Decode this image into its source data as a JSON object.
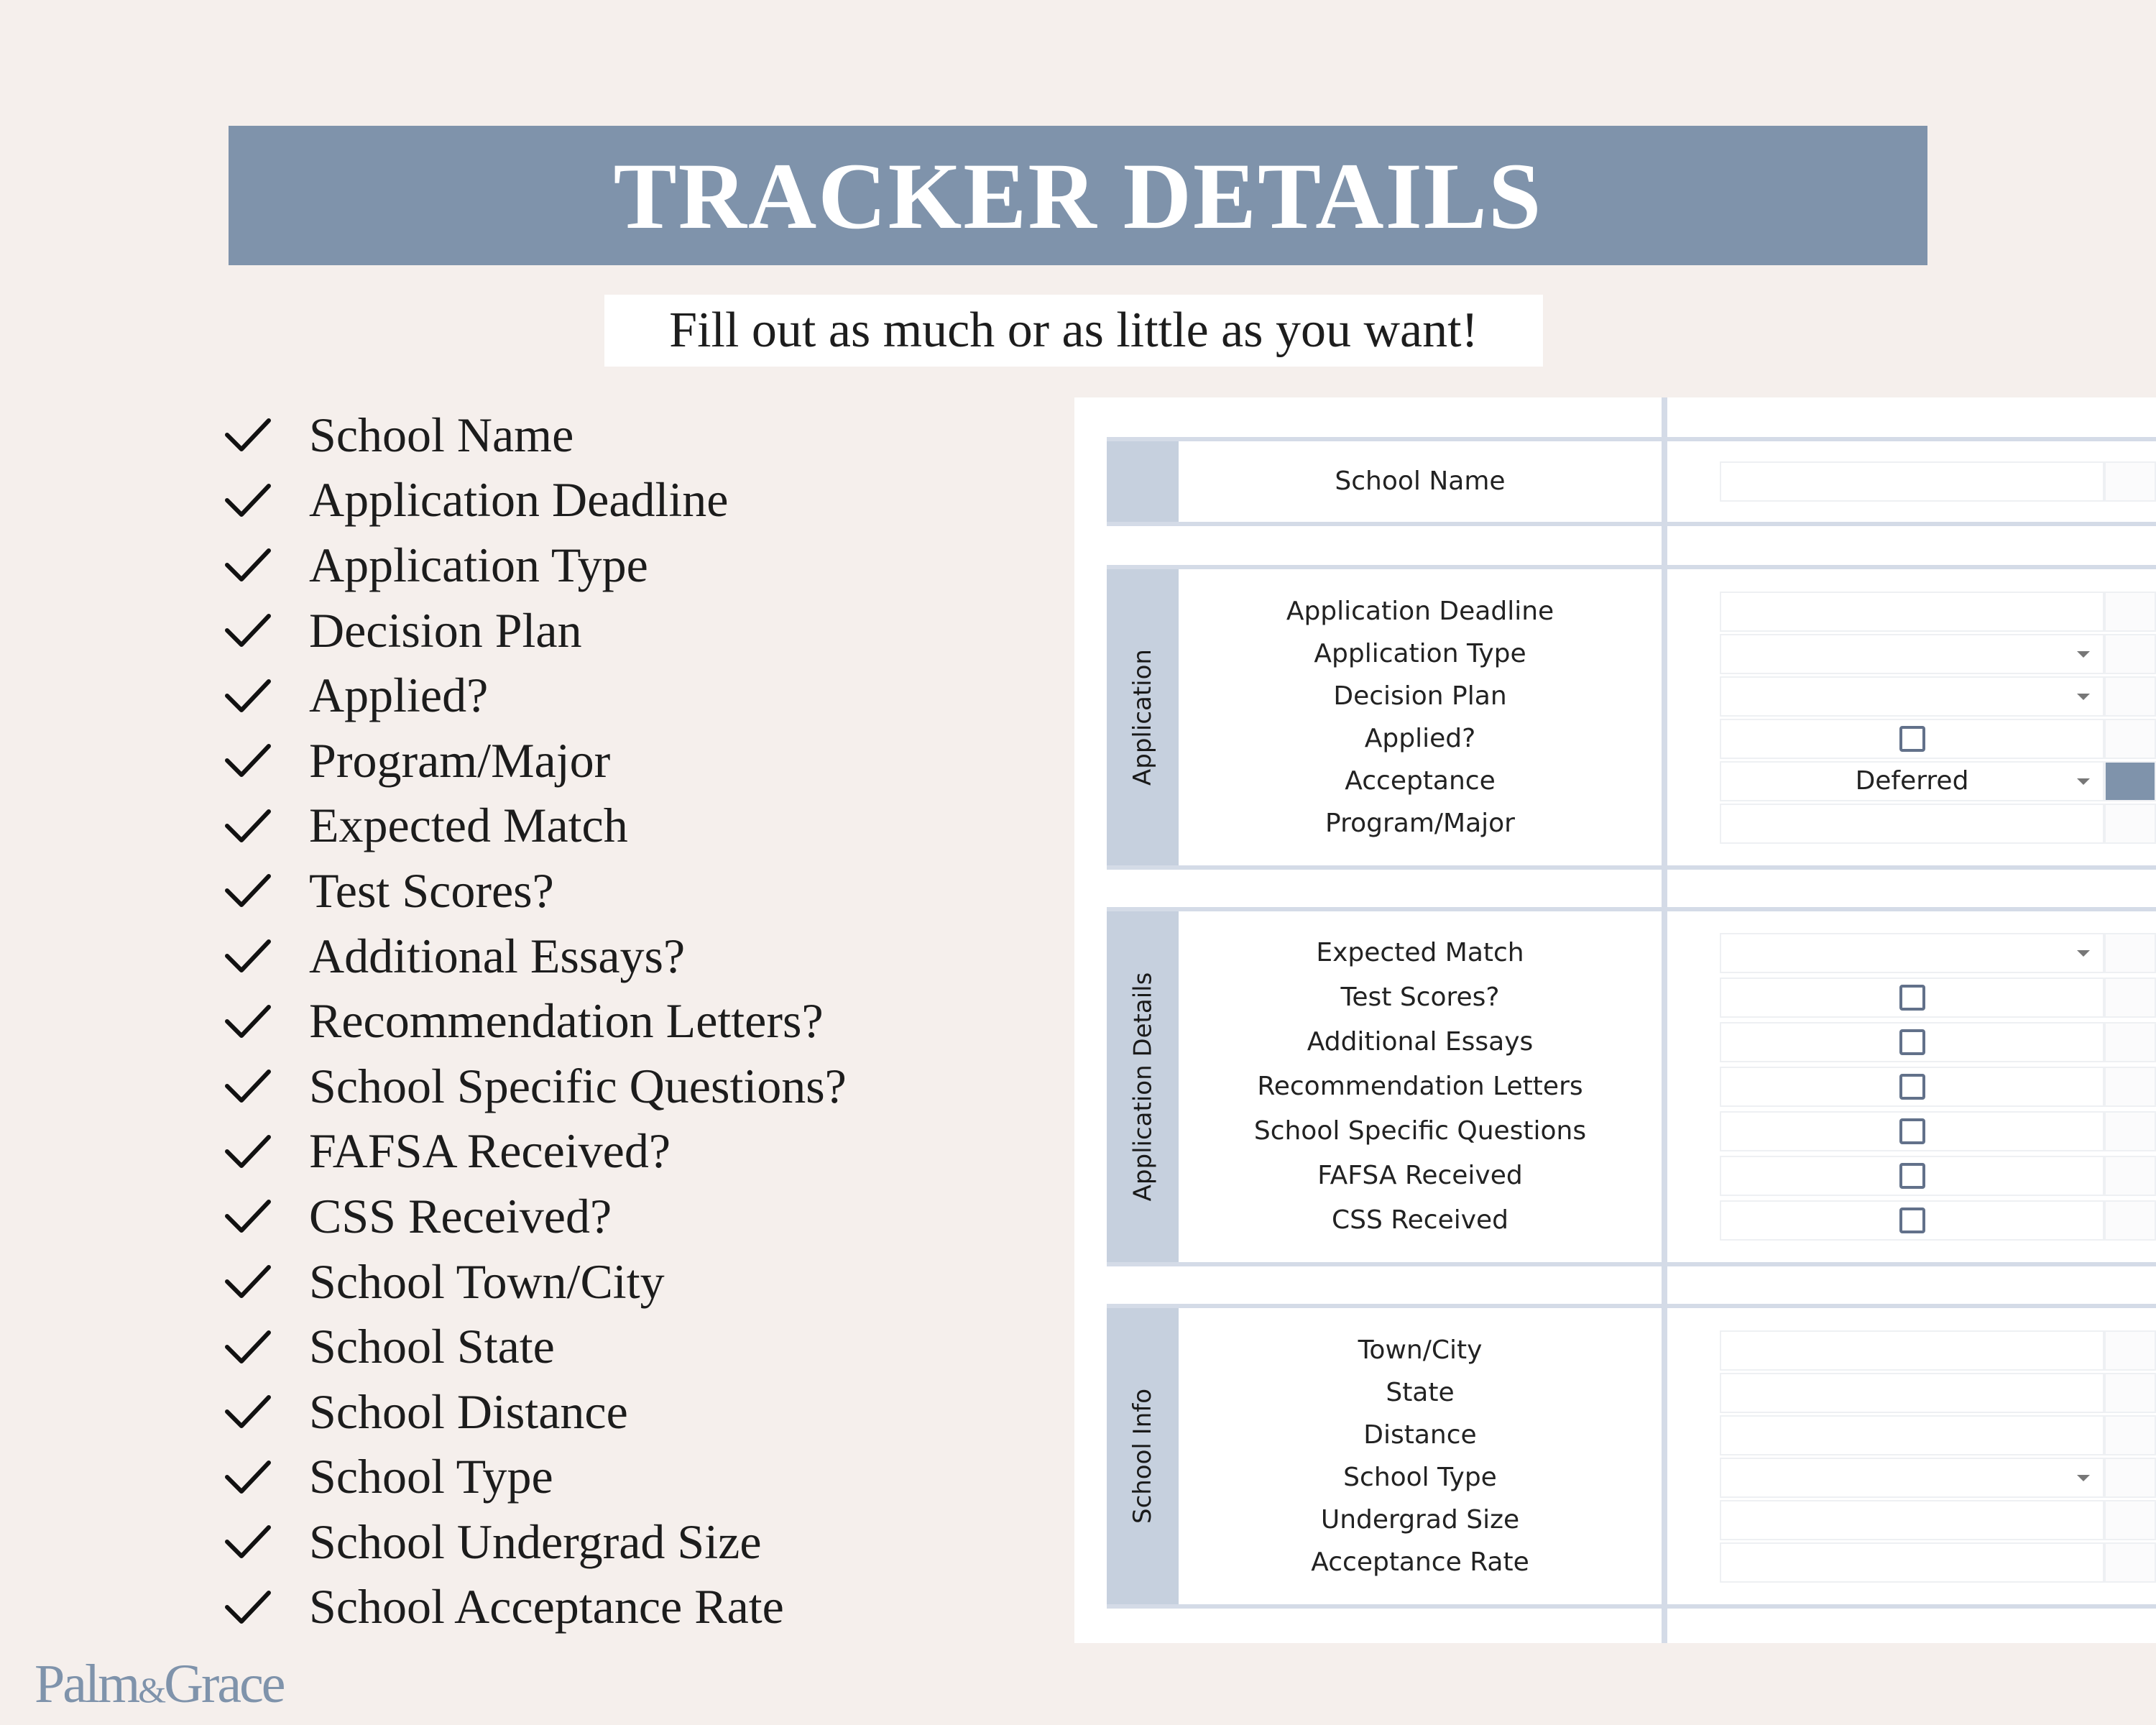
{
  "header": {
    "title": "TRACKER DETAILS",
    "subtitle": "Fill out as much or as little as you want!"
  },
  "checklist": {
    "icon": "checkmark-icon",
    "items": [
      "School Name",
      "Application Deadline",
      "Application Type",
      "Decision Plan",
      "Applied?",
      "Program/Major",
      "Expected Match",
      "Test Scores?",
      "Additional Essays?",
      "Recommendation Letters?",
      "School Specific Questions?",
      "FAFSA Received?",
      "CSS Received?",
      "School Town/City",
      "School State",
      "School Distance",
      "School Type",
      "School Undergrad Size",
      "School Acceptance Rate"
    ]
  },
  "spreadsheet": {
    "sections": [
      {
        "side_label": "",
        "fields": [
          {
            "label": "School Name",
            "type": "text",
            "value": ""
          }
        ]
      },
      {
        "side_label": "Application",
        "fields": [
          {
            "label": "Application Deadline",
            "type": "text",
            "value": ""
          },
          {
            "label": "Application Type",
            "type": "dropdown",
            "value": ""
          },
          {
            "label": "Decision Plan",
            "type": "dropdown",
            "value": ""
          },
          {
            "label": "Applied?",
            "type": "checkbox",
            "checked": false
          },
          {
            "label": "Acceptance",
            "type": "dropdown",
            "value": "Deferred"
          },
          {
            "label": "Program/Major",
            "type": "text",
            "value": ""
          }
        ]
      },
      {
        "side_label": "Application Details",
        "fields": [
          {
            "label": "Expected Match",
            "type": "dropdown",
            "value": ""
          },
          {
            "label": "Test Scores?",
            "type": "checkbox",
            "checked": false
          },
          {
            "label": "Additional Essays",
            "type": "checkbox",
            "checked": false
          },
          {
            "label": "Recommendation Letters",
            "type": "checkbox",
            "checked": false
          },
          {
            "label": "School Specific Questions",
            "type": "checkbox",
            "checked": false
          },
          {
            "label": "FAFSA Received",
            "type": "checkbox",
            "checked": false
          },
          {
            "label": "CSS Received",
            "type": "checkbox",
            "checked": false
          }
        ]
      },
      {
        "side_label": "School Info",
        "fields": [
          {
            "label": "Town/City",
            "type": "text",
            "value": ""
          },
          {
            "label": "State",
            "type": "text",
            "value": ""
          },
          {
            "label": "Distance",
            "type": "text",
            "value": ""
          },
          {
            "label": "School Type",
            "type": "dropdown",
            "value": ""
          },
          {
            "label": "Undergrad Size",
            "type": "text",
            "value": ""
          },
          {
            "label": "Acceptance Rate",
            "type": "text",
            "value": ""
          }
        ]
      }
    ]
  },
  "brand": {
    "name_left": "Palm",
    "amp": "&",
    "name_right": "Grace"
  },
  "colors": {
    "accent": "#7f93ab",
    "background": "#f5efec",
    "section_side": "#c6d0de"
  }
}
